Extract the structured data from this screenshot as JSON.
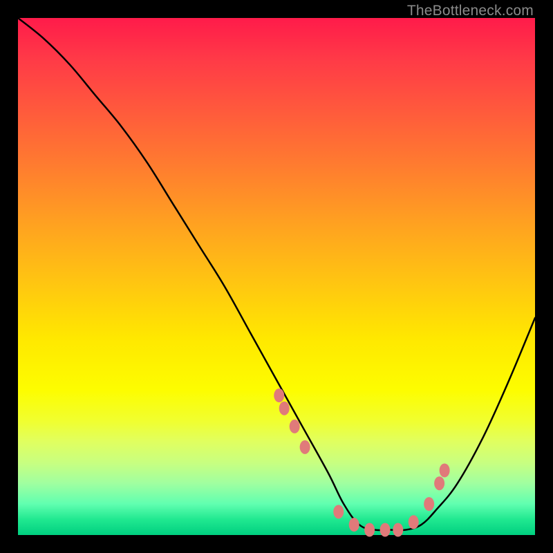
{
  "watermark": "TheBottleneck.com",
  "chart_data": {
    "type": "line",
    "title": "",
    "xlabel": "",
    "ylabel": "",
    "xlim": [
      0,
      100
    ],
    "ylim": [
      0,
      100
    ],
    "series": [
      {
        "name": "curve",
        "x": [
          0,
          5,
          10,
          15,
          20,
          25,
          30,
          35,
          40,
          45,
          50,
          55,
          60,
          63,
          66,
          69,
          72,
          75,
          78,
          81,
          85,
          90,
          95,
          100
        ],
        "values": [
          100,
          96,
          91,
          85,
          79,
          72,
          64,
          56,
          48,
          39,
          30,
          21,
          12,
          6,
          2,
          1,
          1,
          1,
          2,
          5,
          10,
          19,
          30,
          42
        ]
      }
    ],
    "markers": {
      "name": "dots",
      "color": "#e07a7a",
      "x": [
        50.5,
        51.5,
        53.5,
        55.5,
        62,
        65,
        68,
        71,
        73.5,
        76.5,
        79.5,
        81.5,
        82.5
      ],
      "values": [
        27,
        24.5,
        21,
        17,
        4.5,
        2,
        1,
        1,
        1,
        2.5,
        6,
        10,
        12.5
      ]
    }
  },
  "colors": {
    "curve_stroke": "#000000",
    "marker_fill": "#e07a7a",
    "background": "#000000"
  }
}
